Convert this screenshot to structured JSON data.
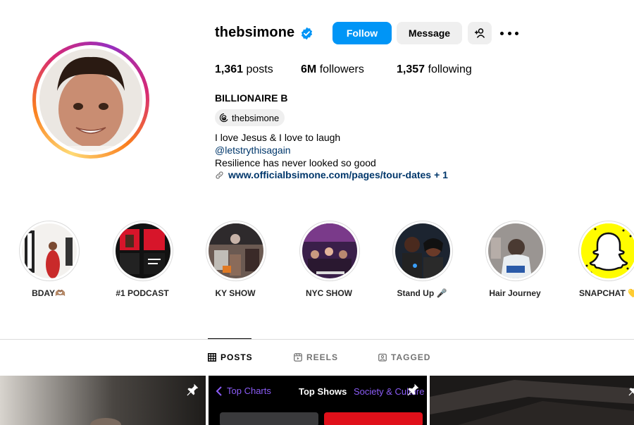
{
  "profile": {
    "username": "thebsimone",
    "verified": true,
    "follow_label": "Follow",
    "message_label": "Message",
    "stats": {
      "posts_count": "1,361",
      "posts_label": "posts",
      "followers_count": "6M",
      "followers_label": "followers",
      "following_count": "1,357",
      "following_label": "following"
    },
    "display_name": "BILLIONAIRE B",
    "threads_handle": "thebsimone",
    "bio": {
      "line1": "I love Jesus & I love to laugh",
      "line2": "@letstrythisagain",
      "line3": "Resilience has never looked so good"
    },
    "link": {
      "url": "www.officialbsimone.com/pages/tour-dates",
      "extra": "+ 1"
    }
  },
  "highlights": [
    {
      "label": "BDAY🫶🏽"
    },
    {
      "label": "#1 PODCAST"
    },
    {
      "label": "KY SHOW"
    },
    {
      "label": "NYC SHOW"
    },
    {
      "label": "Stand Up 🎤"
    },
    {
      "label": "Hair Journey"
    },
    {
      "label": "SNAPCHAT 💛"
    }
  ],
  "tabs": {
    "posts": "POSTS",
    "reels": "REELS",
    "tagged": "TAGGED"
  },
  "grid": {
    "item2": {
      "back_label": "Top Charts",
      "center_label": "Top Shows",
      "right_label": "Society & Culture"
    }
  },
  "colors": {
    "follow_blue": "#0095f6",
    "link_blue": "#00376b",
    "button_gray": "#efefef",
    "divider": "#dbdbdb"
  }
}
